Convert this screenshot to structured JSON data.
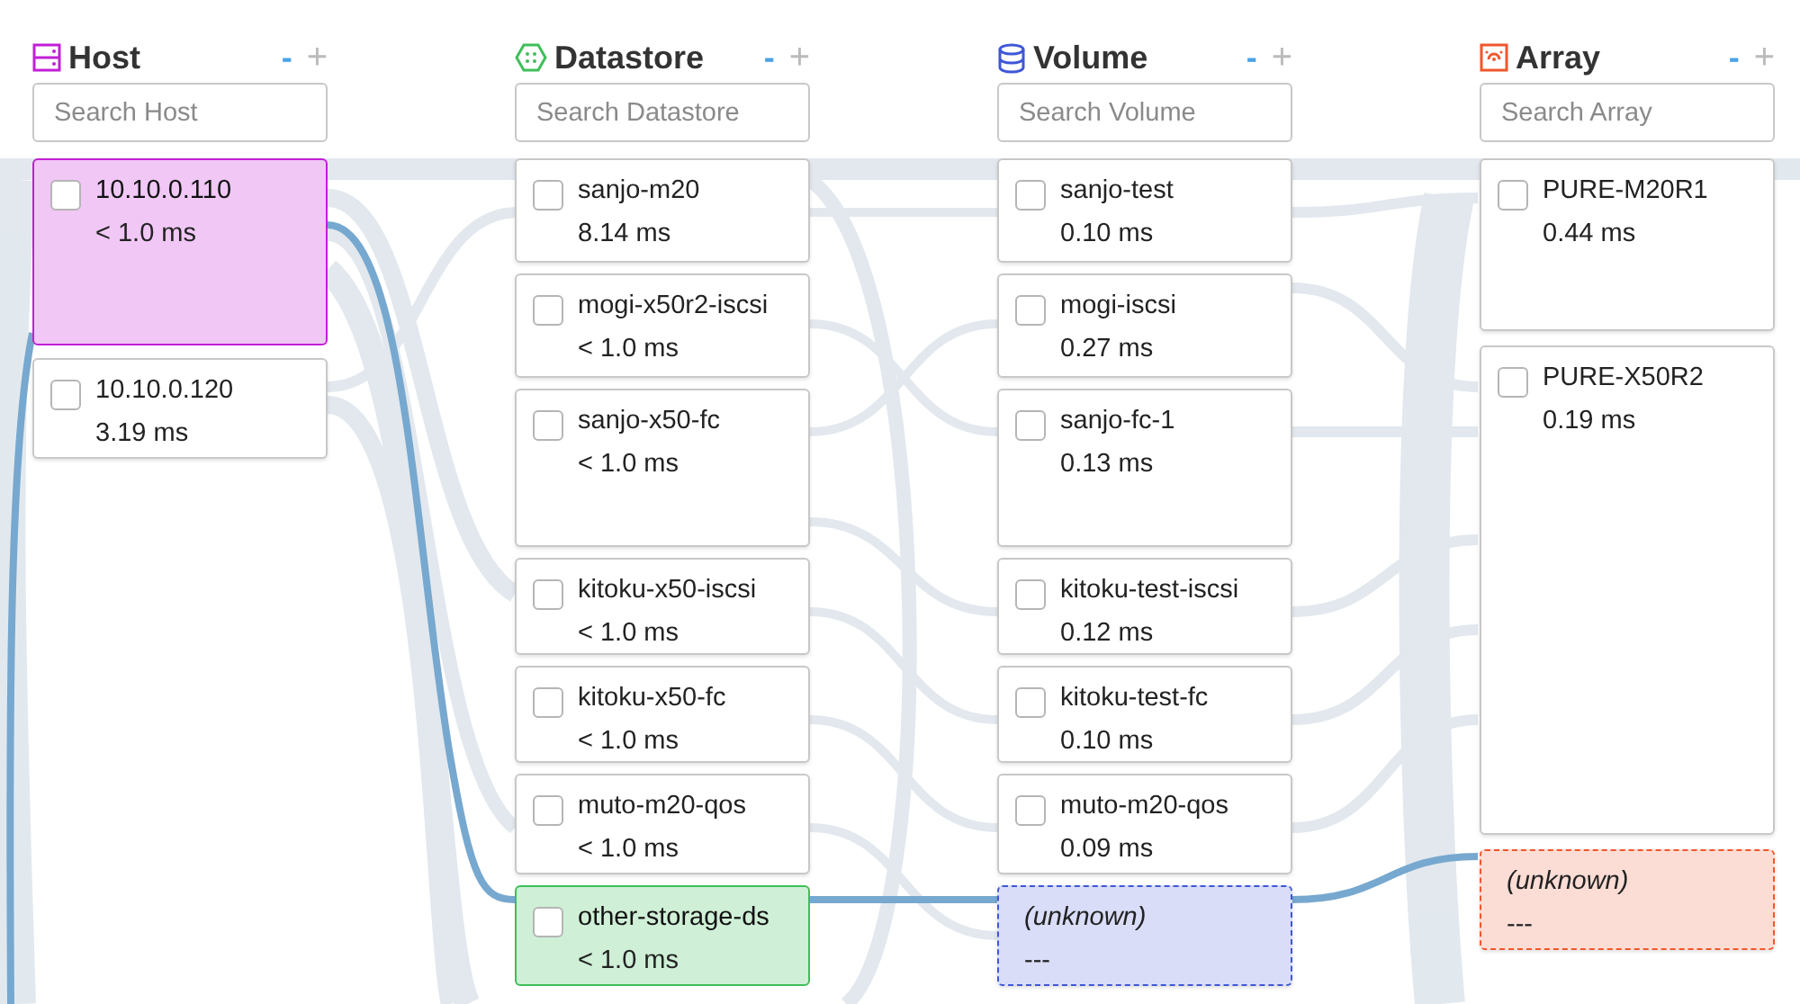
{
  "columns": [
    {
      "kind": "host",
      "title": "Host",
      "color": "#c21fd6",
      "collapse": "-",
      "expand": "+",
      "search": {
        "placeholder": "Search Host"
      },
      "nodes": [
        {
          "kind": "entity",
          "name": "10.10.0.110",
          "latency": "< 1.0 ms",
          "selected": true,
          "checked": false
        },
        {
          "kind": "entity",
          "name": "10.10.0.120",
          "latency": "3.19 ms",
          "selected": false,
          "checked": false
        }
      ]
    },
    {
      "kind": "datastore",
      "title": "Datastore",
      "color": "#3fbf5a",
      "collapse": "-",
      "expand": "+",
      "search": {
        "placeholder": "Search Datastore"
      },
      "nodes": [
        {
          "kind": "entity",
          "name": "sanjo-m20",
          "latency": "8.14 ms",
          "selected": false,
          "checked": false
        },
        {
          "kind": "entity",
          "name": "mogi-x50r2-iscsi",
          "latency": "< 1.0 ms",
          "selected": false,
          "checked": false
        },
        {
          "kind": "entity",
          "name": "sanjo-x50-fc",
          "latency": "< 1.0 ms",
          "selected": false,
          "checked": false
        },
        {
          "kind": "entity",
          "name": "kitoku-x50-iscsi",
          "latency": "< 1.0 ms",
          "selected": false,
          "checked": false
        },
        {
          "kind": "entity",
          "name": "kitoku-x50-fc",
          "latency": "< 1.0 ms",
          "selected": false,
          "checked": false
        },
        {
          "kind": "entity",
          "name": "muto-m20-qos",
          "latency": "< 1.0 ms",
          "selected": false,
          "checked": false
        },
        {
          "kind": "entity",
          "name": "other-storage-ds",
          "latency": "< 1.0 ms",
          "selected": true,
          "checked": false
        }
      ]
    },
    {
      "kind": "volume",
      "title": "Volume",
      "color": "#3f57d6",
      "collapse": "-",
      "expand": "+",
      "search": {
        "placeholder": "Search Volume"
      },
      "nodes": [
        {
          "kind": "entity",
          "name": "sanjo-test",
          "latency": "0.10 ms",
          "selected": false,
          "checked": false
        },
        {
          "kind": "entity",
          "name": "mogi-iscsi",
          "latency": "0.27 ms",
          "selected": false,
          "checked": false
        },
        {
          "kind": "entity",
          "name": "sanjo-fc-1",
          "latency": "0.13 ms",
          "selected": false,
          "checked": false
        },
        {
          "kind": "entity",
          "name": "kitoku-test-iscsi",
          "latency": "0.12 ms",
          "selected": false,
          "checked": false
        },
        {
          "kind": "entity",
          "name": "kitoku-test-fc",
          "latency": "0.10 ms",
          "selected": false,
          "checked": false
        },
        {
          "kind": "entity",
          "name": "muto-m20-qos",
          "latency": "0.09 ms",
          "selected": false,
          "checked": false
        },
        {
          "kind": "unknown",
          "name": "(unknown)",
          "latency": "---"
        }
      ]
    },
    {
      "kind": "array",
      "title": "Array",
      "color": "#f0572c",
      "collapse": "-",
      "expand": "+",
      "search": {
        "placeholder": "Search Array"
      },
      "nodes": [
        {
          "kind": "entity",
          "name": "PURE-M20R1",
          "latency": "0.44 ms",
          "selected": false,
          "checked": false
        },
        {
          "kind": "entity",
          "name": "PURE-X50R2",
          "latency": "0.19 ms",
          "selected": false,
          "checked": false
        },
        {
          "kind": "unknown",
          "name": "(unknown)",
          "latency": "---"
        }
      ]
    }
  ]
}
